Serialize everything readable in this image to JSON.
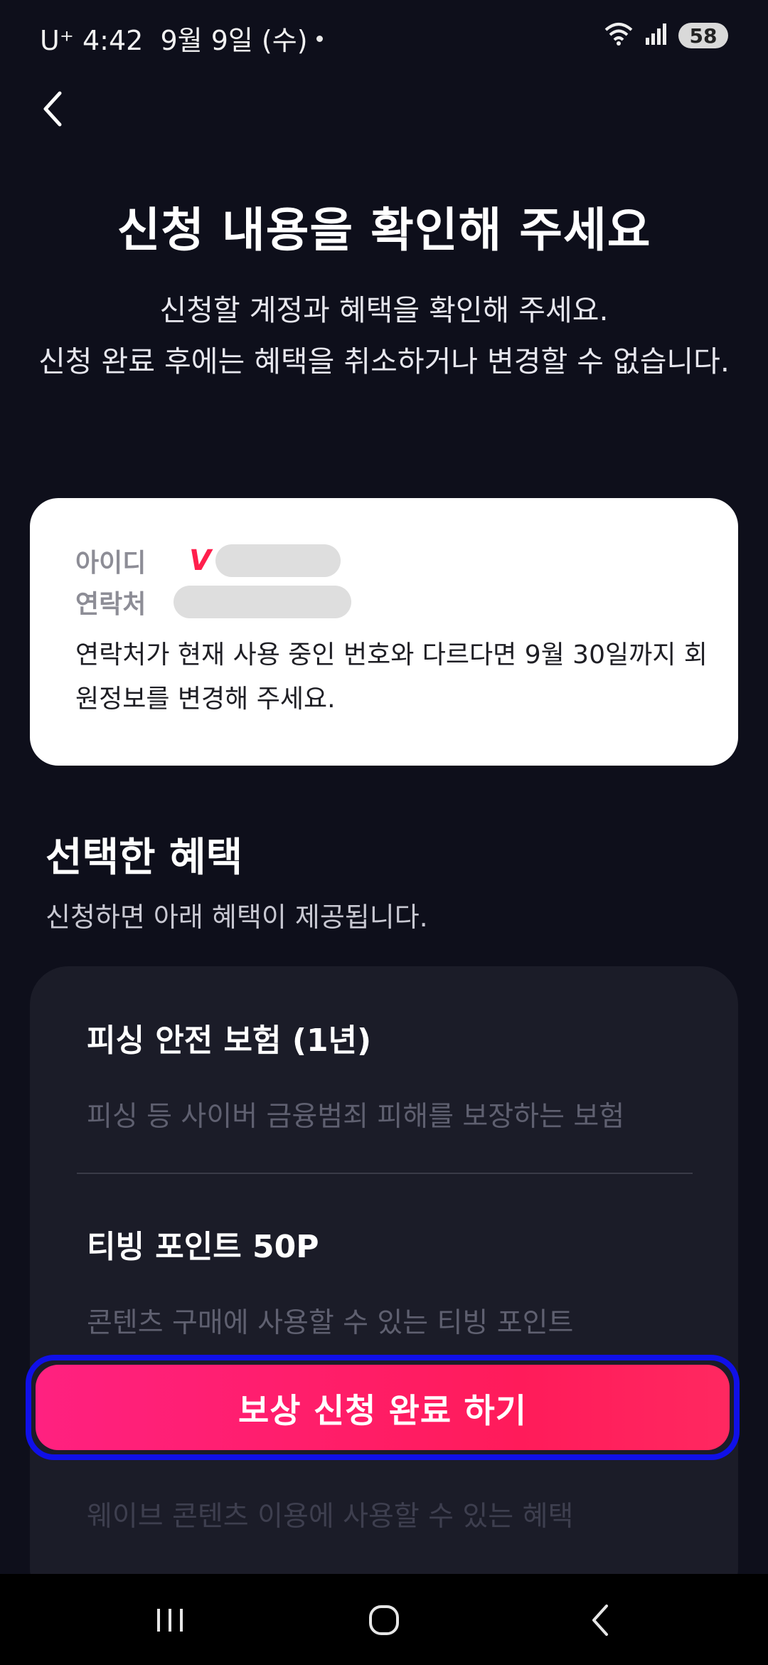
{
  "status_bar": {
    "carrier": "U⁺",
    "time": "4:42",
    "date": "9월 9일 (수)",
    "battery": "58",
    "icons": [
      "wifi-icon",
      "signal-icon",
      "battery-icon"
    ]
  },
  "header": {
    "back_icon": "chevron-left-icon",
    "title": "신청 내용을 확인해 주세요",
    "subtitle_line1": "신청할 계정과 혜택을 확인해 주세요.",
    "subtitle_line2": "신청 완료 후에는 혜택을 취소하거나 변경할 수 없습니다."
  },
  "account": {
    "id_label": "아이디",
    "brand_mark": "V",
    "phone_label": "연락처",
    "notice": "연락처가 현재 사용 중인 번호와 다르다면 9월 30일까지 회원정보를 변경해 주세요."
  },
  "benefits_section": {
    "title": "선택한 혜택",
    "subtitle": "신청하면 아래 혜택이 제공됩니다.",
    "items": [
      {
        "name": "피싱 안전 보험 (1년)",
        "description": "피싱 등 사이버 금융범죄 피해를 보장하는 보험"
      },
      {
        "name": "티빙 포인트 50P",
        "description": "콘텐츠 구매에 사용할 수 있는 티빙 포인트"
      },
      {
        "name": "",
        "description": "웨이브 콘텐츠 이용에 사용할 수 있는 혜택"
      }
    ]
  },
  "cta": {
    "label": "보상 신청 완료 하기"
  },
  "nav_bar": {
    "items": [
      "recent-apps-icon",
      "home-icon",
      "back-icon"
    ]
  },
  "colors": {
    "background": "#0e0f1b",
    "card": "#ffffff",
    "panel": "#1b1c28",
    "accent": "#ff1b5a",
    "focus_ring": "#1010e8"
  }
}
